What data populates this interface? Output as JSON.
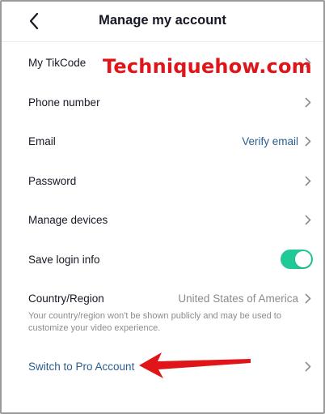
{
  "header": {
    "title": "Manage my account"
  },
  "rows": [
    {
      "label": "My TikCode"
    },
    {
      "label": "Phone number"
    },
    {
      "label": "Email",
      "value": "Verify email"
    },
    {
      "label": "Password"
    },
    {
      "label": "Manage devices"
    },
    {
      "label": "Save login info",
      "toggle_on": true
    },
    {
      "label": "Country/Region",
      "value": "United States of America"
    },
    {
      "label": "Switch to Pro Account"
    }
  ],
  "country_note": "Your country/region won't be shown publicly and may be used to customize your video experience.",
  "watermark": "Techniquehow.com",
  "colors": {
    "accent_link": "#2b5d92",
    "toggle_on": "#20c997",
    "watermark": "#e0151a",
    "arrow": "#e0151a"
  },
  "icons": {
    "back": "chevron-left-icon",
    "row": "chevron-right-icon",
    "annotation": "red-arrow-icon"
  }
}
